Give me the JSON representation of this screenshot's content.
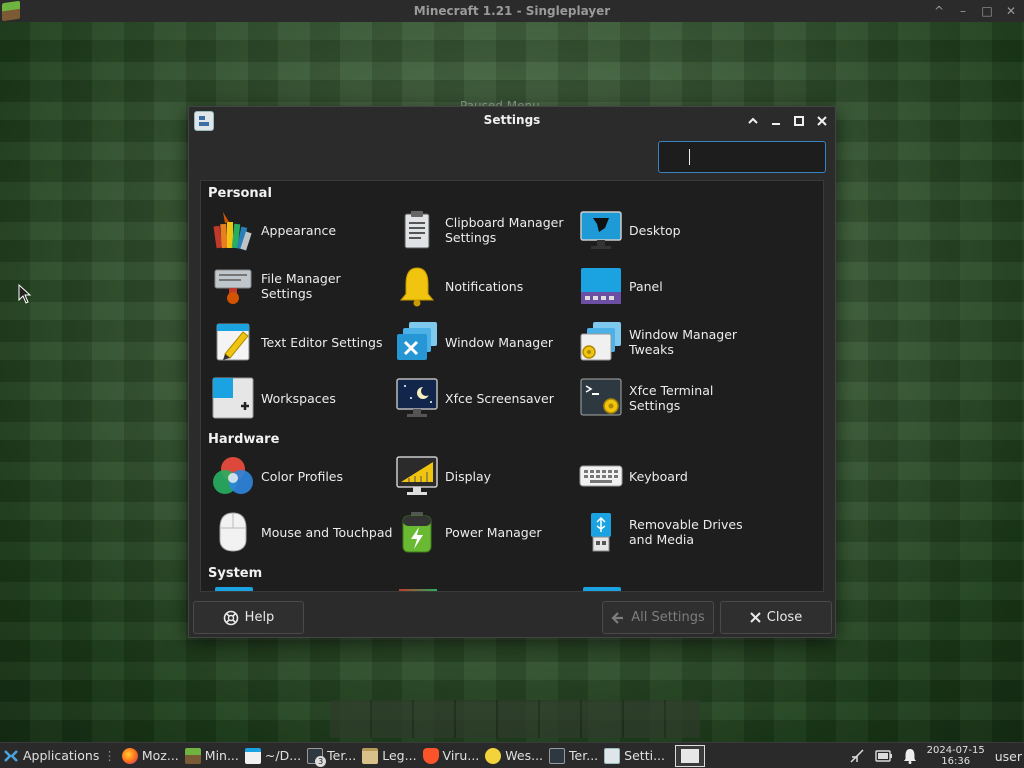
{
  "background_window": {
    "title": "Minecraft 1.21 - Singleplayer",
    "controls": [
      "^",
      "–",
      "□",
      "✕"
    ],
    "blurred_text": "Paused Menu"
  },
  "settings": {
    "title": "Settings",
    "search": {
      "value": "",
      "placeholder": ""
    },
    "sections": {
      "personal": "Personal",
      "hardware": "Hardware",
      "system": "System"
    },
    "personal_items": [
      {
        "label": "Appearance",
        "icon": "appearance-icon"
      },
      {
        "label": "Clipboard Manager Settings",
        "icon": "clipboard-icon"
      },
      {
        "label": "Desktop",
        "icon": "desktop-icon"
      },
      {
        "label": "File Manager Settings",
        "icon": "file-manager-icon"
      },
      {
        "label": "Notifications",
        "icon": "bell-icon"
      },
      {
        "label": "Panel",
        "icon": "panel-icon"
      },
      {
        "label": "Text Editor Settings",
        "icon": "text-editor-icon"
      },
      {
        "label": "Window Manager",
        "icon": "window-manager-icon"
      },
      {
        "label": "Window Manager Tweaks",
        "icon": "window-manager-tweaks-icon"
      },
      {
        "label": "Workspaces",
        "icon": "workspaces-icon"
      },
      {
        "label": "Xfce Screensaver",
        "icon": "screensaver-icon"
      },
      {
        "label": "Xfce Terminal Settings",
        "icon": "terminal-settings-icon"
      }
    ],
    "hardware_items": [
      {
        "label": "Color Profiles",
        "icon": "color-profiles-icon"
      },
      {
        "label": "Display",
        "icon": "display-icon"
      },
      {
        "label": "Keyboard",
        "icon": "keyboard-icon"
      },
      {
        "label": "Mouse and Touchpad",
        "icon": "mouse-icon"
      },
      {
        "label": "Power Manager",
        "icon": "battery-icon"
      },
      {
        "label": "Removable Drives and Media",
        "icon": "usb-drive-icon"
      }
    ],
    "footer": {
      "help": "Help",
      "all_settings": "All Settings",
      "close": "Close"
    }
  },
  "taskbar": {
    "items": [
      {
        "label": "Applications",
        "icon": "xfce-menu-icon"
      },
      {
        "label": "Moz...",
        "icon": "firefox-icon"
      },
      {
        "label": "Min...",
        "icon": "minecraft-icon"
      },
      {
        "label": "~/D...",
        "icon": "text-editor-icon"
      },
      {
        "label": "Ter...",
        "icon": "terminal-icon",
        "badge": "3"
      },
      {
        "label": "Leg...",
        "icon": "folder-icon"
      },
      {
        "label": "Viru...",
        "icon": "brave-icon"
      },
      {
        "label": "Wes...",
        "icon": "browser-icon"
      },
      {
        "label": "Ter...",
        "icon": "terminal-icon"
      },
      {
        "label": "Setti...",
        "icon": "settings-icon"
      }
    ],
    "clock_date": "2024-07-15",
    "clock_time": "16:36",
    "user": "user"
  }
}
